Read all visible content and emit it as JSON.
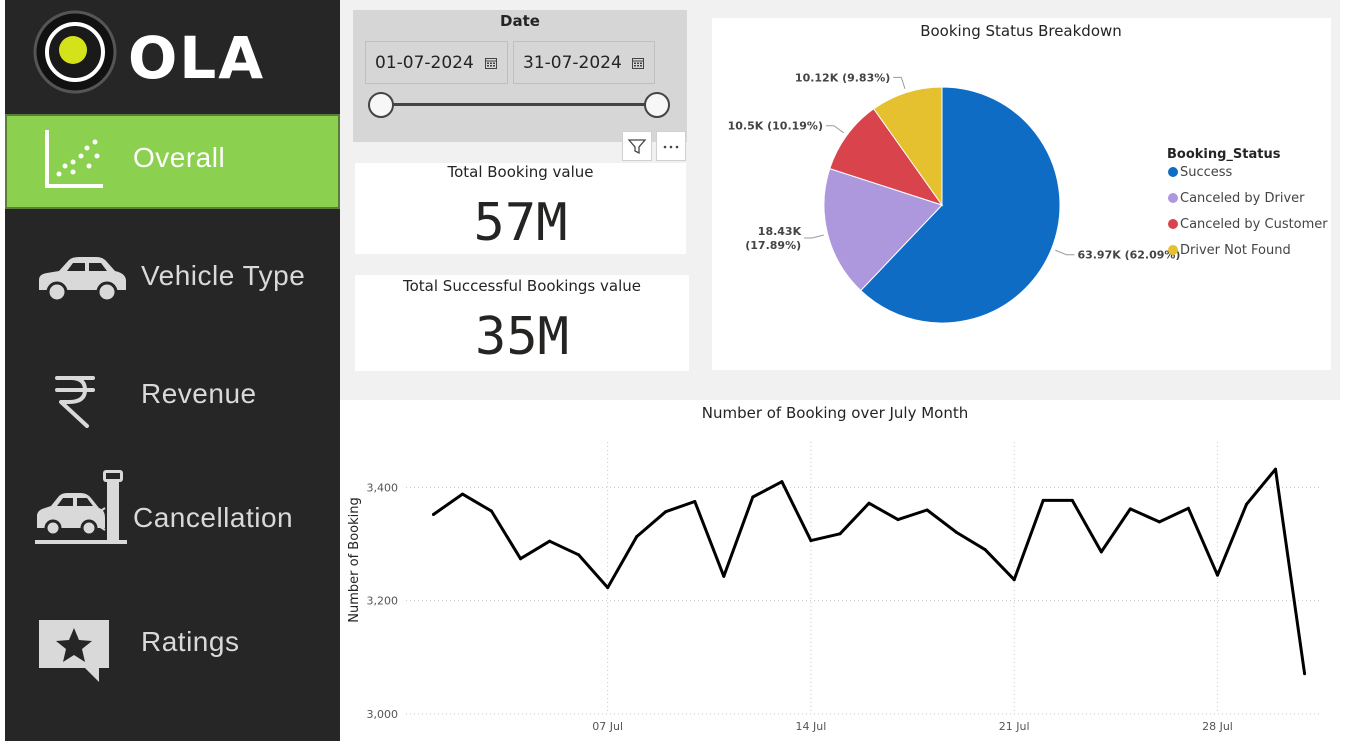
{
  "brand": {
    "name": "OLA",
    "accent": "#8bd14f",
    "sidebar_bg": "#262626"
  },
  "nav": {
    "items": [
      {
        "label": "Overall",
        "icon": "scatter-chart-icon",
        "active": true
      },
      {
        "label": "Vehicle Type",
        "icon": "car-icon",
        "active": false
      },
      {
        "label": "Revenue",
        "icon": "rupee-icon",
        "active": false
      },
      {
        "label": "Cancellation",
        "icon": "car-crash-icon",
        "active": false
      },
      {
        "label": "Ratings",
        "icon": "star-comment-icon",
        "active": false
      }
    ]
  },
  "slicer": {
    "title": "Date",
    "start_date": "01-07-2024",
    "end_date": "31-07-2024",
    "range": [
      0,
      1
    ],
    "tools": {
      "filter_icon": "filter-icon",
      "more_icon": "more-options-icon"
    }
  },
  "kpis": {
    "total_booking": {
      "title": "Total Booking value",
      "value": "57M"
    },
    "total_successful": {
      "title": "Total Successful Bookings value",
      "value": "35M"
    }
  },
  "chart_data": [
    {
      "type": "pie",
      "title": "Booking Status Breakdown",
      "legend_title": "Booking_Status",
      "legend_position": "right",
      "slices": [
        {
          "name": "Success",
          "value": 63970,
          "label": "63.97K (62.09%)",
          "color": "#0f6cc4"
        },
        {
          "name": "Canceled by Driver",
          "value": 18430,
          "label_line1": "18.43K",
          "label_line2": "(17.89%)",
          "color": "#ad98de"
        },
        {
          "name": "Canceled by Customer",
          "value": 10500,
          "label": "10.5K (10.19%)",
          "color": "#d9444c"
        },
        {
          "name": "Driver Not Found",
          "value": 10120,
          "label": "10.12K (9.83%)",
          "color": "#e5c02f"
        }
      ]
    },
    {
      "type": "line",
      "title": "Number of Booking over July Month",
      "xlabel": "",
      "ylabel": "Number of Booking",
      "ylim": [
        3000,
        3480
      ],
      "yticks": [
        3000,
        3200,
        3400
      ],
      "ytick_labels": [
        "3,000",
        "3,200",
        "3,400"
      ],
      "xticks": [
        7,
        14,
        21,
        28
      ],
      "xtick_labels": [
        "07 Jul",
        "14 Jul",
        "21 Jul",
        "28 Jul"
      ],
      "x": [
        1,
        2,
        3,
        4,
        5,
        6,
        7,
        8,
        9,
        10,
        11,
        12,
        13,
        14,
        15,
        16,
        17,
        18,
        19,
        20,
        21,
        22,
        23,
        24,
        25,
        26,
        27,
        28,
        29,
        30,
        31
      ],
      "values": [
        3352,
        3388,
        3358,
        3274,
        3305,
        3281,
        3223,
        3313,
        3357,
        3375,
        3243,
        3383,
        3410,
        3306,
        3318,
        3372,
        3343,
        3360,
        3321,
        3290,
        3237,
        3377,
        3377,
        3286,
        3362,
        3339,
        3363,
        3245,
        3370,
        3432,
        3071
      ],
      "line_color": "#000000",
      "grid": true
    }
  ]
}
